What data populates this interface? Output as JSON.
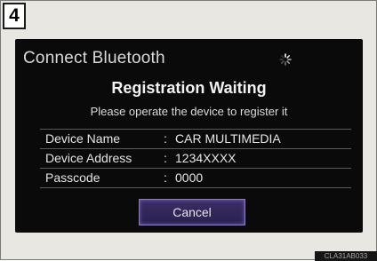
{
  "step": {
    "number": "4"
  },
  "screen": {
    "title": "Connect Bluetooth",
    "spinner_icon": "loading-spinner-icon",
    "headline": "Registration Waiting",
    "instruction": "Please operate the device to register it",
    "fields": [
      {
        "label": "Device Name",
        "separator": ":",
        "value": "CAR MULTIMEDIA"
      },
      {
        "label": "Device Address",
        "separator": ":",
        "value": "1234XXXX"
      },
      {
        "label": "Passcode",
        "separator": ":",
        "value": "0000"
      }
    ],
    "cancel_label": "Cancel"
  },
  "footer": {
    "image_code": "CLA31AB033"
  },
  "colors": {
    "screen_background": "#0a0a0a",
    "button_border": "#8d7bd0",
    "frame_background": "#e8e7e2"
  }
}
